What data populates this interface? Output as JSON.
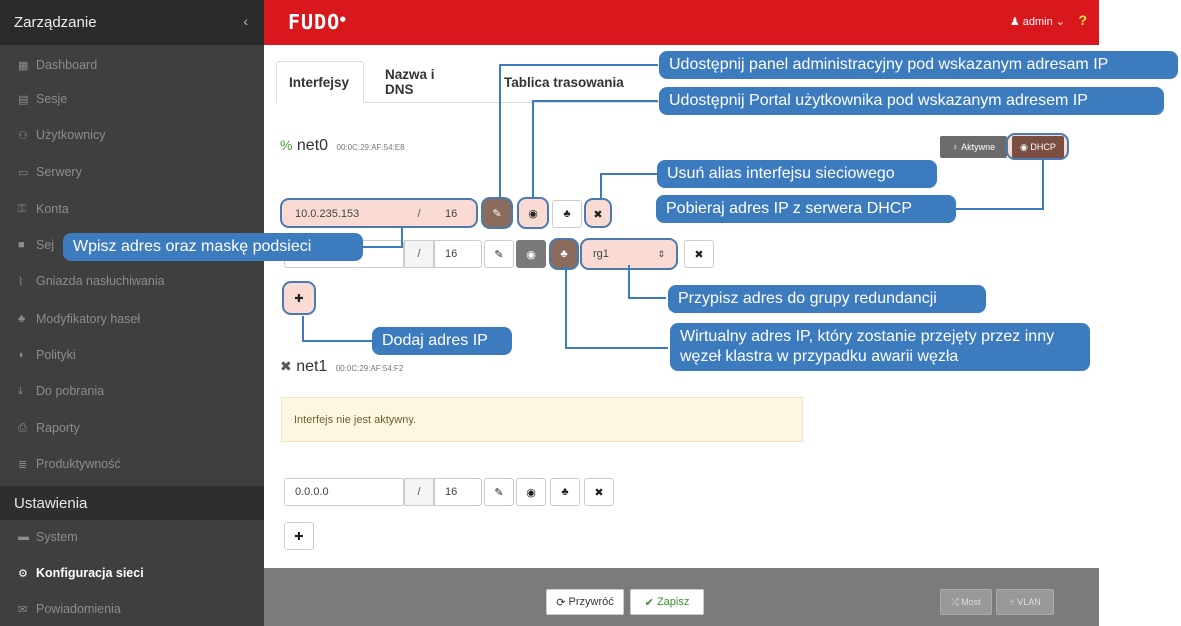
{
  "sidebar": {
    "header": "Zarządzanie",
    "collapse_icon": "chevron-left-icon",
    "items": [
      {
        "label": "Dashboard",
        "icon": "dashboard-icon"
      },
      {
        "label": "Sesje",
        "icon": "film-icon"
      },
      {
        "label": "Użytkownicy",
        "icon": "users-icon"
      },
      {
        "label": "Serwery",
        "icon": "server-icon"
      },
      {
        "label": "Konta",
        "icon": "key-icon"
      },
      {
        "label": "Sej",
        "icon": "safe-icon"
      },
      {
        "label": "Gniazda nasłuchiwania",
        "icon": "rss-icon"
      },
      {
        "label": "Modyfikatory haseł",
        "icon": "sitemap-icon"
      },
      {
        "label": "Polityki",
        "icon": "shield-icon"
      },
      {
        "label": "Do pobrania",
        "icon": "download-icon"
      },
      {
        "label": "Raporty",
        "icon": "print-icon"
      },
      {
        "label": "Produktywność",
        "icon": "chart-icon"
      }
    ],
    "section2": "Ustawienia",
    "items2": [
      {
        "label": "System",
        "icon": "folder-icon"
      },
      {
        "label": "Konfiguracja sieci",
        "icon": "cogs-icon"
      },
      {
        "label": "Powiadomienia",
        "icon": "envelope-icon"
      }
    ]
  },
  "topbar": {
    "logo": "FUDO",
    "user": "admin",
    "help": "?"
  },
  "tabs": [
    "Interfejsy",
    "Nazwa i DNS",
    "Tablica trasowania"
  ],
  "net0": {
    "name": "net0",
    "mac": "00:0C:29:AF:54:E8",
    "active_label": "Aktywne",
    "dhcp_label": "DHCP",
    "row1": {
      "ip": "10.0.235.153",
      "slash": "/",
      "mask": "16"
    },
    "row2": {
      "slash": "/",
      "mask": "16",
      "group": "rg1"
    }
  },
  "net1": {
    "name": "net1",
    "mac": "00:0C:29:AF:54:F2",
    "warning": "Interfejs nie jest aktywny.",
    "row1": {
      "ip": "0.0.0.0",
      "slash": "/",
      "mask": "16"
    }
  },
  "footer": {
    "restore": "Przywróć",
    "save": "Zapisz",
    "bridge": "Most",
    "vlan": "VLAN"
  },
  "callouts": {
    "admin_panel": "Udostępnij panel administracyjny pod wskazanym adresam IP",
    "user_portal": "Udostępnij Portal użytkownika pod wskazanym adresem IP",
    "remove_alias": "Usuń alias interfejsu sieciowego",
    "dhcp": "Pobieraj adres IP z serwera DHCP",
    "ip_mask": "Wpisz adres oraz maskę podsieci",
    "redundancy": "Przypisz adres do grupy redundancji",
    "add_ip": "Dodaj adres IP",
    "virtual_ip": "Wirtualny adres IP, który zostanie przejęty przez inny węzeł klastra w przypadku awarii węzła"
  }
}
